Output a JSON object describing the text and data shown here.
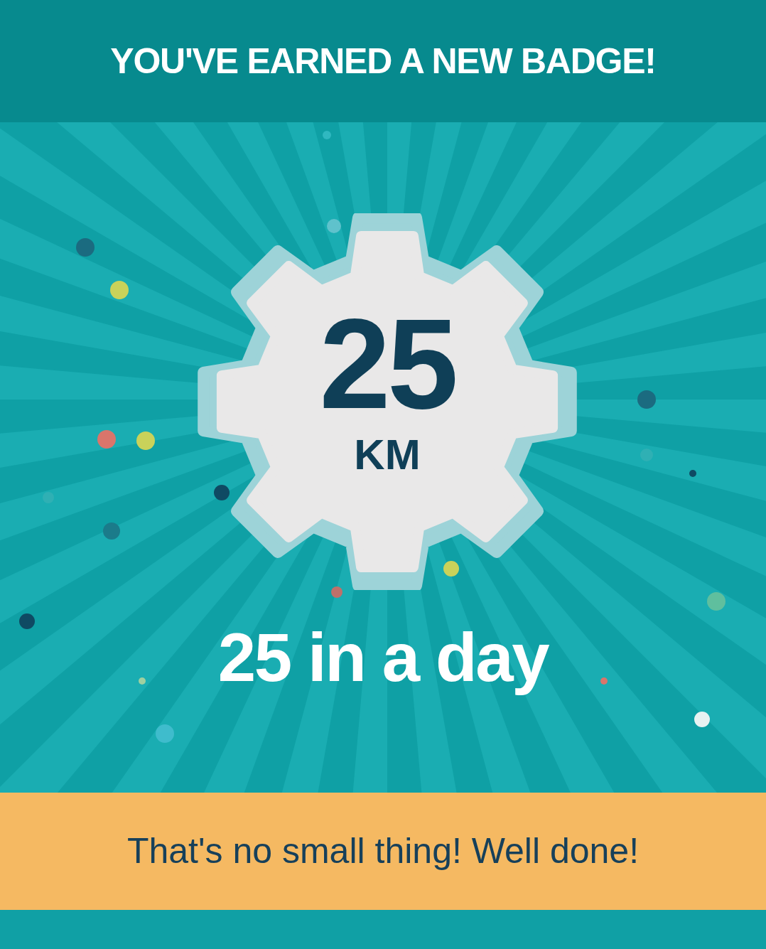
{
  "header": {
    "title": "YOU'VE EARNED A NEW BADGE!"
  },
  "badge": {
    "value": "25",
    "unit": "KM",
    "name": "25 in a day"
  },
  "message": {
    "text": "That's no small thing! Well done!"
  }
}
